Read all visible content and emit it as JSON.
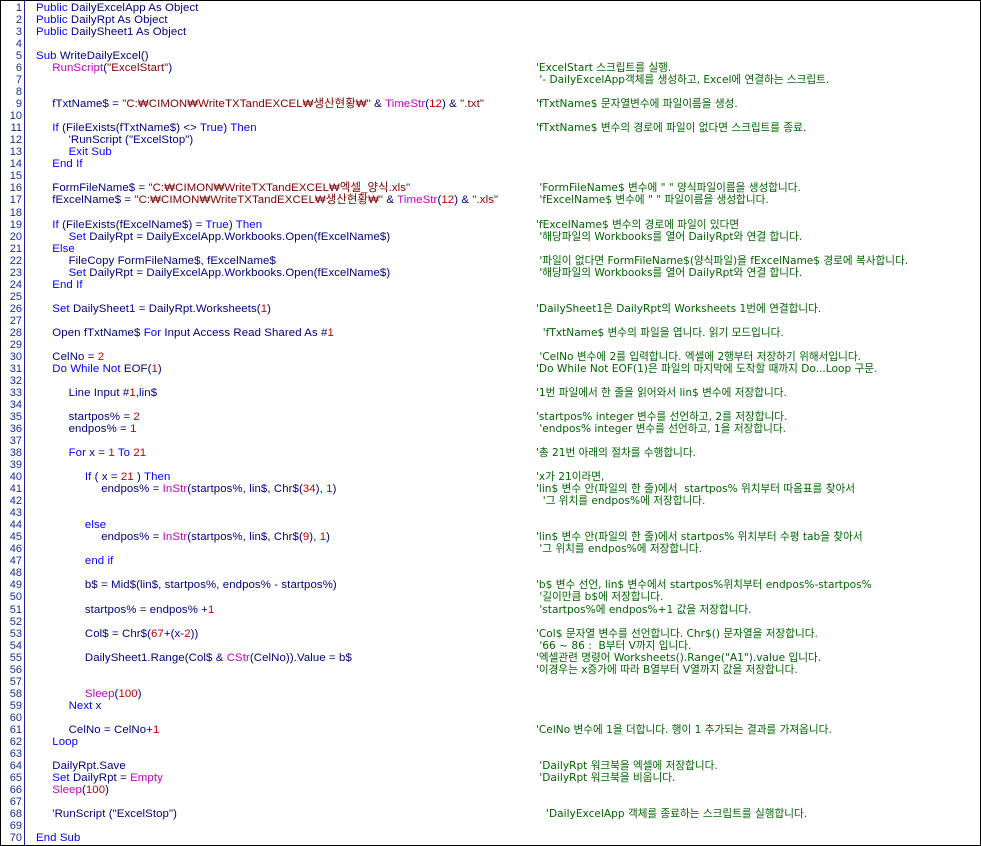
{
  "colors": {
    "plain": "#000080",
    "keyword": "#0000ff",
    "string": "#800000",
    "function": "#c000c0",
    "number": "#c00000",
    "comment": "#006400",
    "line_number": "#1a2a9a"
  },
  "lines": [
    {
      "n": "1",
      "indent": 0,
      "code": [
        [
          "k",
          "Public"
        ],
        [
          "p",
          " DailyExcelApp As Object"
        ]
      ],
      "comment": ""
    },
    {
      "n": "2",
      "indent": 0,
      "code": [
        [
          "k",
          "Public"
        ],
        [
          "p",
          " DailyRpt As Object"
        ]
      ],
      "comment": ""
    },
    {
      "n": "3",
      "indent": 0,
      "code": [
        [
          "k",
          "Public"
        ],
        [
          "p",
          " DailySheet1 As Object"
        ]
      ],
      "comment": ""
    },
    {
      "n": "4",
      "indent": 0,
      "code": [],
      "comment": ""
    },
    {
      "n": "5",
      "indent": 0,
      "code": [
        [
          "k",
          "Sub"
        ],
        [
          "p",
          " WriteDailyExcel()"
        ]
      ],
      "comment": ""
    },
    {
      "n": "6",
      "indent": 1,
      "code": [
        [
          "f",
          "RunScript"
        ],
        [
          "p",
          "("
        ],
        [
          "s",
          "\"ExcelStart\""
        ],
        [
          "p",
          ")"
        ]
      ],
      "comment": "'ExcelStart 스크립트를 실행."
    },
    {
      "n": "7",
      "indent": 0,
      "code": [],
      "comment": " '- DailyExcelApp객체를 생성하고, Excel에 연결하는 스크립트."
    },
    {
      "n": "8",
      "indent": 0,
      "code": [],
      "comment": ""
    },
    {
      "n": "9",
      "indent": 1,
      "code": [
        [
          "p",
          "fTxtName$ = "
        ],
        [
          "s",
          "\"C:₩CIMON₩WriteTXTandEXCEL₩생산현황₩\""
        ],
        [
          "p",
          " & "
        ],
        [
          "f",
          "TimeStr"
        ],
        [
          "p",
          "("
        ],
        [
          "n",
          "12"
        ],
        [
          "p",
          ") & "
        ],
        [
          "s",
          "\".txt\""
        ]
      ],
      "comment": "'fTxtName$ 문자열변수에 파일이름을 생성."
    },
    {
      "n": "10",
      "indent": 0,
      "code": [],
      "comment": ""
    },
    {
      "n": "11",
      "indent": 1,
      "code": [
        [
          "k",
          "If"
        ],
        [
          "p",
          " (FileExists(fTxtName$) <> "
        ],
        [
          "k",
          "True"
        ],
        [
          "p",
          ") "
        ],
        [
          "k",
          "Then"
        ]
      ],
      "comment": "'fTxtName$ 변수의 경로에 파일이 없다면 스크립트를 종료."
    },
    {
      "n": "12",
      "indent": 2,
      "code": [
        [
          "p",
          "'RunScript (\"ExcelStop\")"
        ]
      ],
      "comment": ""
    },
    {
      "n": "13",
      "indent": 2,
      "code": [
        [
          "k",
          "Exit Sub"
        ]
      ],
      "comment": ""
    },
    {
      "n": "14",
      "indent": 1,
      "code": [
        [
          "k",
          "End If"
        ]
      ],
      "comment": ""
    },
    {
      "n": "15",
      "indent": 0,
      "code": [],
      "comment": ""
    },
    {
      "n": "16",
      "indent": 1,
      "code": [
        [
          "p",
          "FormFileName$ = "
        ],
        [
          "s",
          "\"C:₩CIMON₩WriteTXTandEXCEL₩엑셀_양식.xls\""
        ]
      ],
      "comment": " 'FormFileName$ 변수에 \" \" 양식파일이름을 생성합니다."
    },
    {
      "n": "17",
      "indent": 1,
      "code": [
        [
          "p",
          "fExcelName$ = "
        ],
        [
          "s",
          "\"C:₩CIMON₩WriteTXTandEXCEL₩생산현황₩\""
        ],
        [
          "p",
          " & "
        ],
        [
          "f",
          "TimeStr"
        ],
        [
          "p",
          "("
        ],
        [
          "n",
          "12"
        ],
        [
          "p",
          ") & "
        ],
        [
          "s",
          "\".xls\""
        ]
      ],
      "comment": " 'fExcelName$ 변수에 \" \" 파일이름을 생성합니다."
    },
    {
      "n": "18",
      "indent": 0,
      "code": [],
      "comment": ""
    },
    {
      "n": "19",
      "indent": 1,
      "code": [
        [
          "k",
          "If"
        ],
        [
          "p",
          " (FileExists(fExcelName$) = "
        ],
        [
          "k",
          "True"
        ],
        [
          "p",
          ") "
        ],
        [
          "k",
          "Then"
        ]
      ],
      "comment": "'fExcelName$ 변수의 경로에 파일이 있다면"
    },
    {
      "n": "20",
      "indent": 2,
      "code": [
        [
          "k",
          "Set"
        ],
        [
          "p",
          " DailyRpt = DailyExcelApp.Workbooks.Open(fExcelName$)"
        ]
      ],
      "comment": " '해당파일의 Workbooks를 열어 DailyRpt와 연결 합니다."
    },
    {
      "n": "21",
      "indent": 1,
      "code": [
        [
          "k",
          "Else"
        ]
      ],
      "comment": ""
    },
    {
      "n": "22",
      "indent": 2,
      "code": [
        [
          "p",
          "FileCopy FormFileName$, fExcelName$"
        ]
      ],
      "comment": " '파일이 없다면 FormFileName$(양식파일)을 fExcelName$ 경로에 복사합니다."
    },
    {
      "n": "23",
      "indent": 2,
      "code": [
        [
          "k",
          "Set"
        ],
        [
          "p",
          " DailyRpt = DailyExcelApp.Workbooks.Open(fExcelName$)"
        ]
      ],
      "comment": " '해당파일의 Workbooks를 열어 DailyRpt와 연결 합니다."
    },
    {
      "n": "24",
      "indent": 1,
      "code": [
        [
          "k",
          "End If"
        ]
      ],
      "comment": ""
    },
    {
      "n": "25",
      "indent": 0,
      "code": [],
      "comment": ""
    },
    {
      "n": "26",
      "indent": 1,
      "code": [
        [
          "k",
          "Set"
        ],
        [
          "p",
          " DailySheet1 = DailyRpt.Worksheets("
        ],
        [
          "n",
          "1"
        ],
        [
          "p",
          ")"
        ]
      ],
      "comment": "'DailySheet1은 DailyRpt의 Worksheets 1번에 연결합니다."
    },
    {
      "n": "27",
      "indent": 0,
      "code": [],
      "comment": ""
    },
    {
      "n": "28",
      "indent": 1,
      "code": [
        [
          "p",
          "Open fTxtName$ "
        ],
        [
          "k",
          "For"
        ],
        [
          "p",
          " Input Access Read Shared As #"
        ],
        [
          "n",
          "1"
        ]
      ],
      "comment": "  'fTxtName$ 변수의 파일을 엽니다. 읽기 모드입니다."
    },
    {
      "n": "29",
      "indent": 0,
      "code": [],
      "comment": ""
    },
    {
      "n": "30",
      "indent": 1,
      "code": [
        [
          "p",
          "CelNo = "
        ],
        [
          "n",
          "2"
        ]
      ],
      "comment": " 'CelNo 변수에 2를 입력합니다. 엑셀에 2행부터 저장하기 위해서입니다."
    },
    {
      "n": "31",
      "indent": 1,
      "code": [
        [
          "k",
          "Do While Not"
        ],
        [
          "p",
          " EOF("
        ],
        [
          "n",
          "1"
        ],
        [
          "p",
          ")"
        ]
      ],
      "comment": "'Do While Not EOF(1)은 파일의 마지막에 도착할 때까지 Do...Loop 구문."
    },
    {
      "n": "32",
      "indent": 0,
      "code": [],
      "comment": ""
    },
    {
      "n": "33",
      "indent": 2,
      "code": [
        [
          "p",
          "Line Input #"
        ],
        [
          "n",
          "1"
        ],
        [
          "p",
          ",lin$"
        ]
      ],
      "comment": "'1번 파일에서 한 줄을 읽어와서 lin$ 변수에 저장합니다."
    },
    {
      "n": "34",
      "indent": 0,
      "code": [],
      "comment": ""
    },
    {
      "n": "35",
      "indent": 2,
      "code": [
        [
          "p",
          "startpos% = "
        ],
        [
          "n",
          "2"
        ]
      ],
      "comment": "'startpos% integer 변수를 선언하고, 2를 저장합니다."
    },
    {
      "n": "36",
      "indent": 2,
      "code": [
        [
          "p",
          "endpos% = "
        ],
        [
          "n",
          "1"
        ]
      ],
      "comment": " 'endpos% integer 변수를 선언하고, 1을 저장합니다."
    },
    {
      "n": "37",
      "indent": 0,
      "code": [],
      "comment": ""
    },
    {
      "n": "38",
      "indent": 2,
      "code": [
        [
          "k",
          "For"
        ],
        [
          "p",
          " x = "
        ],
        [
          "n",
          "1"
        ],
        [
          "k",
          " To "
        ],
        [
          "n",
          "21"
        ]
      ],
      "comment": "'총 21번 아래의 절차를 수행합니다."
    },
    {
      "n": "39",
      "indent": 0,
      "code": [],
      "comment": ""
    },
    {
      "n": "40",
      "indent": 3,
      "code": [
        [
          "k",
          "If"
        ],
        [
          "p",
          " ( x = "
        ],
        [
          "n",
          "21"
        ],
        [
          "p",
          " ) "
        ],
        [
          "k",
          "Then"
        ]
      ],
      "comment": "'x가 21이라면,"
    },
    {
      "n": "41",
      "indent": 4,
      "code": [
        [
          "p",
          "endpos% = "
        ],
        [
          "f",
          "InStr"
        ],
        [
          "p",
          "(startpos%, lin$, Chr$("
        ],
        [
          "n",
          "34"
        ],
        [
          "p",
          "), "
        ],
        [
          "n",
          "1"
        ],
        [
          "p",
          ")"
        ]
      ],
      "comment": "'lin$ 변수 안(파일의 한 줄)에서  startpos% 위치부터 따옴표를 찾아서"
    },
    {
      "n": "42",
      "indent": 0,
      "code": [],
      "comment": "  '그 위치를 endpos%에 저장합니다."
    },
    {
      "n": "43",
      "indent": 0,
      "code": [],
      "comment": ""
    },
    {
      "n": "44",
      "indent": 3,
      "code": [
        [
          "k",
          "else"
        ]
      ],
      "comment": ""
    },
    {
      "n": "45",
      "indent": 4,
      "code": [
        [
          "p",
          "endpos% = "
        ],
        [
          "f",
          "InStr"
        ],
        [
          "p",
          "(startpos%, lin$, Chr$("
        ],
        [
          "n",
          "9"
        ],
        [
          "p",
          "), "
        ],
        [
          "n",
          "1"
        ],
        [
          "p",
          ")"
        ]
      ],
      "comment": "'lin$ 변수 안(파일의 한 줄)에서 startpos% 위치부터 수평 tab을 찾아서"
    },
    {
      "n": "46",
      "indent": 0,
      "code": [],
      "comment": " '그 위치를 endpos%에 저장합니다."
    },
    {
      "n": "47",
      "indent": 3,
      "code": [
        [
          "k",
          "end if"
        ]
      ],
      "comment": ""
    },
    {
      "n": "48",
      "indent": 0,
      "code": [],
      "comment": ""
    },
    {
      "n": "49",
      "indent": 3,
      "code": [
        [
          "p",
          "b$ = Mid$(lin$, startpos%, endpos% - startpos%)"
        ]
      ],
      "comment": "'b$ 변수 선언, lin$ 변수에서 startpos%위치부터 endpos%-startpos%"
    },
    {
      "n": "50",
      "indent": 0,
      "code": [],
      "comment": " '길이만큼 b$에 저장합니다."
    },
    {
      "n": "51",
      "indent": 3,
      "code": [
        [
          "p",
          "startpos% = endpos% +"
        ],
        [
          "n",
          "1"
        ]
      ],
      "comment": " 'startpos%에 endpos%+1 값을 저장합니다."
    },
    {
      "n": "52",
      "indent": 0,
      "code": [],
      "comment": ""
    },
    {
      "n": "53",
      "indent": 3,
      "code": [
        [
          "p",
          "Col$ = Chr$("
        ],
        [
          "n",
          "67"
        ],
        [
          "p",
          "+(x-"
        ],
        [
          "n",
          "2"
        ],
        [
          "p",
          "))"
        ]
      ],
      "comment": "'Col$ 문자열 변수를 선언합니다. Chr$() 문자열을 저장합니다."
    },
    {
      "n": "54",
      "indent": 0,
      "code": [],
      "comment": " '66 ~ 86 :  B부터 V까지 입니다."
    },
    {
      "n": "55",
      "indent": 3,
      "code": [
        [
          "p",
          "DailySheet1.Range(Col$ & "
        ],
        [
          "f",
          "CStr"
        ],
        [
          "p",
          "(CelNo)).Value = b$"
        ]
      ],
      "comment": "'엑셀관련 명령어 Worksheets().Range(\"A1\").value 입니다."
    },
    {
      "n": "56",
      "indent": 0,
      "code": [],
      "comment": "'이경우는 x증가에 따라 B열부터 V열까지 값을 저장합니다."
    },
    {
      "n": "57",
      "indent": 0,
      "code": [],
      "comment": ""
    },
    {
      "n": "58",
      "indent": 3,
      "code": [
        [
          "f",
          "Sleep"
        ],
        [
          "p",
          "("
        ],
        [
          "n",
          "100"
        ],
        [
          "p",
          ")"
        ]
      ],
      "comment": ""
    },
    {
      "n": "59",
      "indent": 2,
      "code": [
        [
          "k",
          "Next"
        ],
        [
          "p",
          " x"
        ]
      ],
      "comment": ""
    },
    {
      "n": "60",
      "indent": 0,
      "code": [],
      "comment": ""
    },
    {
      "n": "61",
      "indent": 2,
      "code": [
        [
          "p",
          "CelNo = CelNo+"
        ],
        [
          "n",
          "1"
        ]
      ],
      "comment": "'CelNo 변수에 1을 더합니다. 행이 1 추가되는 결과를 가져옵니다."
    },
    {
      "n": "62",
      "indent": 1,
      "code": [
        [
          "k",
          "Loop"
        ]
      ],
      "comment": ""
    },
    {
      "n": "63",
      "indent": 0,
      "code": [],
      "comment": ""
    },
    {
      "n": "64",
      "indent": 1,
      "code": [
        [
          "p",
          "DailyRpt.Save"
        ]
      ],
      "comment": " 'DailyRpt 워크북을 엑셀에 저장합니다."
    },
    {
      "n": "65",
      "indent": 1,
      "code": [
        [
          "k",
          "Set"
        ],
        [
          "p",
          " DailyRpt = "
        ],
        [
          "f",
          "Empty"
        ]
      ],
      "comment": " 'DailyRpt 워크북을 비웁니다."
    },
    {
      "n": "66",
      "indent": 1,
      "code": [
        [
          "f",
          "Sleep"
        ],
        [
          "p",
          "("
        ],
        [
          "n",
          "100"
        ],
        [
          "p",
          ")"
        ]
      ],
      "comment": ""
    },
    {
      "n": "67",
      "indent": 0,
      "code": [],
      "comment": ""
    },
    {
      "n": "68",
      "indent": 1,
      "code": [
        [
          "p",
          "'RunScript (\"ExcelStop\")"
        ]
      ],
      "comment": "   'DailyExcelApp 객체를 종료하는 스크립트를 실행합니다."
    },
    {
      "n": "69",
      "indent": 0,
      "code": [],
      "comment": ""
    },
    {
      "n": "70",
      "indent": 0,
      "code": [
        [
          "k",
          "End Sub"
        ]
      ],
      "comment": ""
    }
  ]
}
